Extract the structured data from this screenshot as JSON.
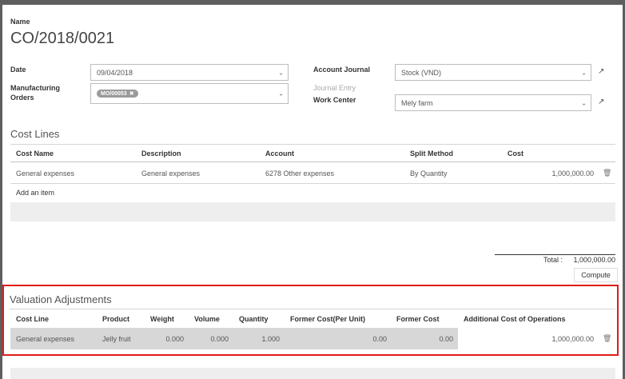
{
  "form": {
    "name_label": "Name",
    "name_value": "CO/2018/0021",
    "date_label": "Date",
    "date_value": "09/04/2018",
    "mo_label_1": "Manufacturing",
    "mo_label_2": "Orders",
    "mo_tag": "MO/00053",
    "account_journal_label": "Account Journal",
    "account_journal_value": "Stock (VND)",
    "journal_entry_label": "Journal Entry",
    "work_center_label": "Work Center",
    "work_center_value": "Mely farm"
  },
  "cost_lines": {
    "title": "Cost Lines",
    "headers": [
      "Cost Name",
      "Description",
      "Account",
      "Split Method",
      "Cost"
    ],
    "rows": [
      {
        "cost_name": "General expenses",
        "description": "General expenses",
        "account": "6278 Other expenses",
        "split_method": "By Quantity",
        "cost": "1,000,000.00"
      }
    ],
    "add_item": "Add an item"
  },
  "totals": {
    "total_label": "Total :",
    "total_value": "1,000,000.00",
    "compute_label": "Compute"
  },
  "valuation": {
    "title": "Valuation Adjustments",
    "headers": [
      "Cost Line",
      "Product",
      "Weight",
      "Volume",
      "Quantity",
      "Former Cost(Per Unit)",
      "Former Cost",
      "Additional Cost of Operations"
    ],
    "rows": [
      {
        "cost_line": "General expenses",
        "product": "Jelly fruit",
        "weight": "0.000",
        "volume": "0.000",
        "quantity": "1.000",
        "former_cost_unit": "0.00",
        "former_cost": "0.00",
        "additional_cost": "1,000,000.00"
      }
    ]
  },
  "icons": {
    "external": "external-link-icon",
    "caret": "chevron-down-icon",
    "trash": "trash-icon",
    "tag_remove": "close-icon"
  },
  "colors": {
    "highlight_border": "#e01b1b",
    "window_frame": "#5e5e5e"
  }
}
